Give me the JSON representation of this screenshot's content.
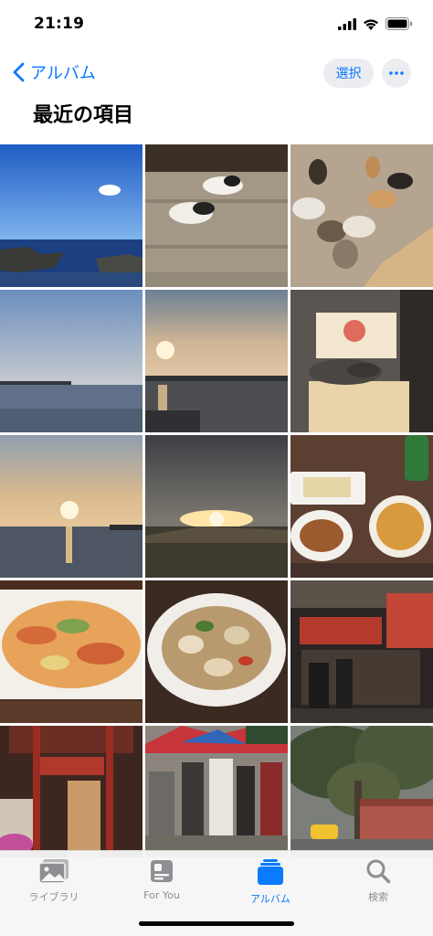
{
  "status_bar": {
    "time": "21:19"
  },
  "nav": {
    "back_label": "アルバム",
    "select_label": "選択",
    "title": "最近の項目"
  },
  "photos": [
    {
      "subject": "sky-and-sea-rocks"
    },
    {
      "subject": "cats-on-steps"
    },
    {
      "subject": "many-cats"
    },
    {
      "subject": "dusk-sea"
    },
    {
      "subject": "sunset-harbor"
    },
    {
      "subject": "cat-on-shrine-board"
    },
    {
      "subject": "sunset-sea"
    },
    {
      "subject": "sunset-over-field"
    },
    {
      "subject": "dinner-table-dishes"
    },
    {
      "subject": "garlic-shrimp"
    },
    {
      "subject": "clam-dish"
    },
    {
      "subject": "night-market-stall"
    },
    {
      "subject": "temple-interior"
    },
    {
      "subject": "street-market-crowd"
    },
    {
      "subject": "tree-and-taxi"
    }
  ],
  "tab_bar": {
    "tabs": [
      {
        "label": "ライブラリ",
        "icon": "photo-library-icon",
        "active": false
      },
      {
        "label": "For You",
        "icon": "for-you-icon",
        "active": false
      },
      {
        "label": "アルバム",
        "icon": "albums-icon",
        "active": true
      },
      {
        "label": "検索",
        "icon": "search-icon",
        "active": false
      }
    ]
  },
  "colors": {
    "accent": "#0a7aff",
    "inactive": "#8e8e93"
  }
}
